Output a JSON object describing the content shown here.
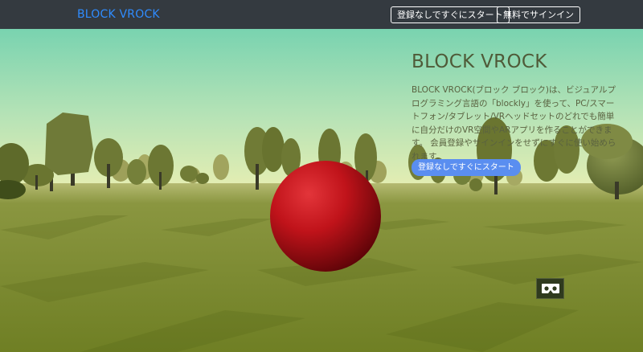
{
  "navbar": {
    "brand": "BLOCK VROCK",
    "start_button": "登録なしですぐにスタート",
    "signin_button": "無料でサインイン"
  },
  "hero": {
    "title": "BLOCK VROCK",
    "description": "BLOCK VROCK(ブロック ブロック)は、ビジュアルプログラミング言語の「blockly」を使って、PC/スマートフォン/タブレット/VRヘッドセットのどれでも簡単に自分だけのVR空間やARアプリを作ることができます。 会員登録やサインインをせずにすぐに使い始められます。",
    "start_button": "登録なしですぐにスタート"
  },
  "scene": {
    "sky_top": "#7fd6b2",
    "sky_horizon": "#dcecae",
    "ground": "#7f8c2e",
    "sphere": "#c0131a"
  },
  "vr_button": {
    "icon": "cardboard-vr-icon"
  }
}
